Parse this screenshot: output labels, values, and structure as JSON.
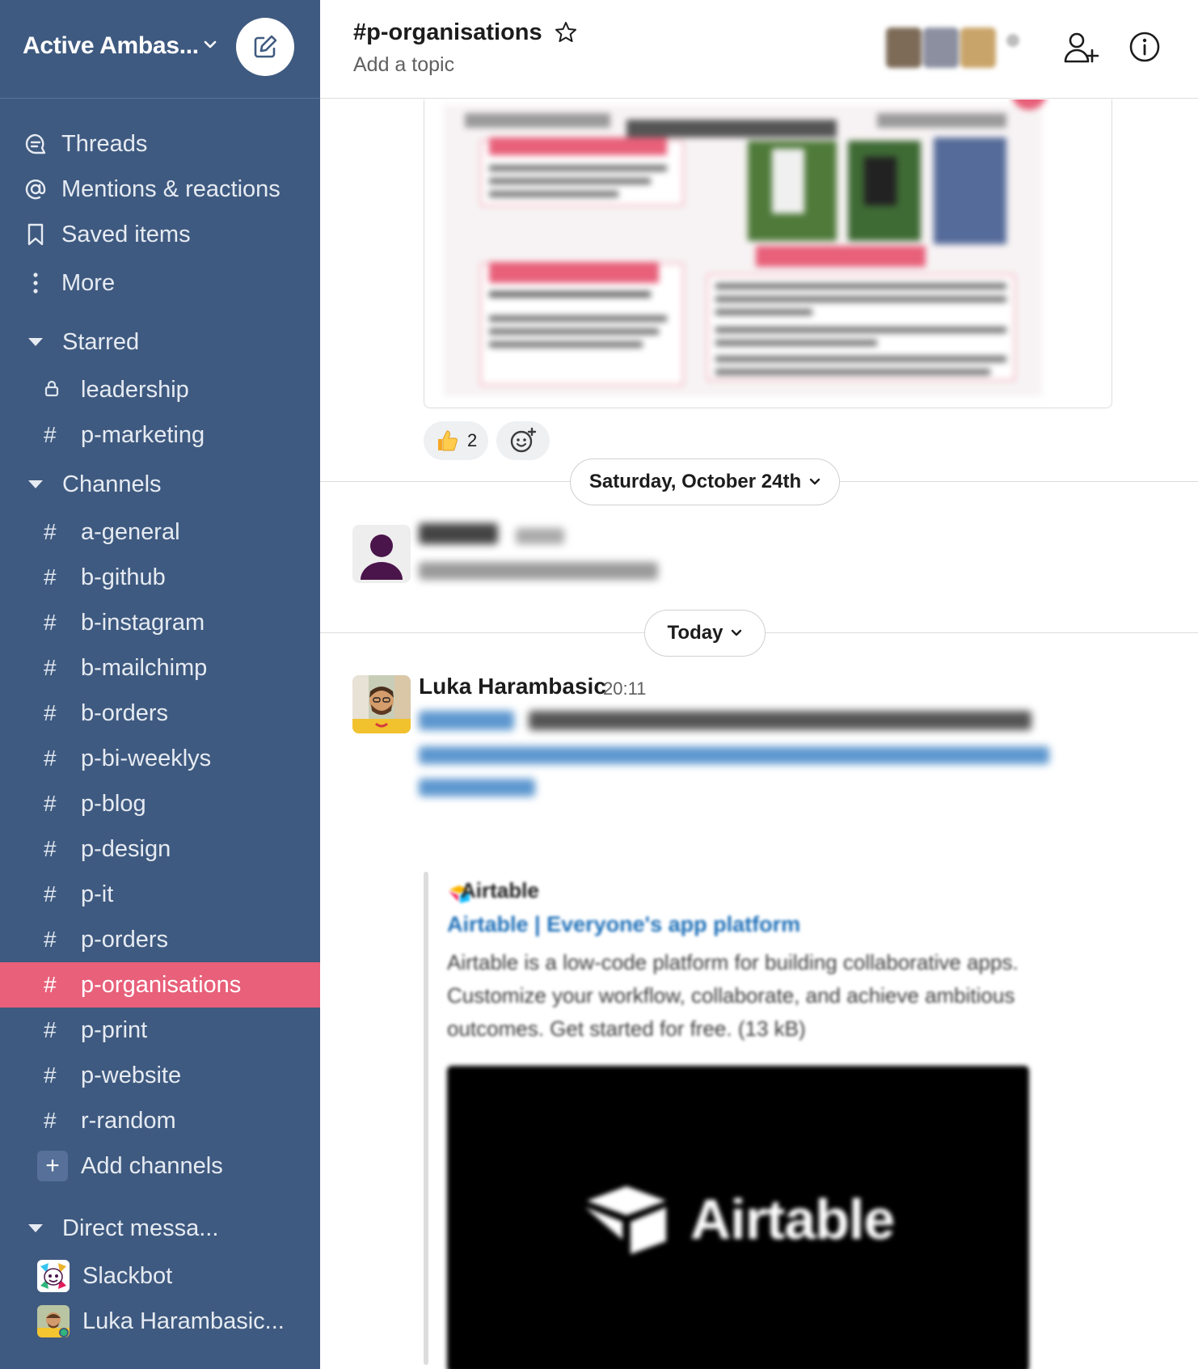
{
  "workspace": {
    "name": "Active Ambas..."
  },
  "nav": [
    {
      "icon": "threads-icon",
      "label": "Threads"
    },
    {
      "icon": "at-sign-icon",
      "label": "Mentions & reactions"
    },
    {
      "icon": "bookmark-icon",
      "label": "Saved items"
    },
    {
      "icon": "more-vertical-icon",
      "label": "More"
    }
  ],
  "sections": {
    "starred": "Starred",
    "channels": "Channels",
    "direct": "Direct messa..."
  },
  "starred_items": [
    {
      "prefix": "lock",
      "label": "leadership"
    },
    {
      "prefix": "#",
      "label": "p-marketing"
    }
  ],
  "channels": [
    {
      "hash": "#",
      "label": "a-general"
    },
    {
      "hash": "#",
      "label": "b-github"
    },
    {
      "hash": "#",
      "label": "b-instagram"
    },
    {
      "hash": "#",
      "label": "b-mailchimp"
    },
    {
      "hash": "#",
      "label": "b-orders"
    },
    {
      "hash": "#",
      "label": "p-bi-weeklys"
    },
    {
      "hash": "#",
      "label": "p-blog"
    },
    {
      "hash": "#",
      "label": "p-design"
    },
    {
      "hash": "#",
      "label": "p-it"
    },
    {
      "hash": "#",
      "label": "p-orders"
    },
    {
      "hash": "#",
      "label": "p-organisations"
    },
    {
      "hash": "#",
      "label": "p-print"
    },
    {
      "hash": "#",
      "label": "p-website"
    },
    {
      "hash": "#",
      "label": "r-random"
    }
  ],
  "add_channels": {
    "plus": "+",
    "label": "Add channels"
  },
  "direct_messages": [
    {
      "label": "Slackbot"
    },
    {
      "label": "Luka Harambasic..."
    }
  ],
  "header": {
    "channel": "#p-organisations",
    "topic": "Add a topic"
  },
  "reactions": {
    "thumbs_count": "2"
  },
  "dates": {
    "first": "Saturday, October 24th",
    "second": "Today"
  },
  "message": {
    "author": "Luka Harambasic",
    "time": "20:11"
  },
  "attachment": {
    "site": "Airtable",
    "title": "Airtable | Everyone's app platform",
    "description": "Airtable is a low-code platform for building collaborative apps. Customize your workflow, collaborate, and achieve ambitious outcomes. Get started for free. (13 kB)",
    "image_brand": "Airtable"
  },
  "colors": {
    "sidebar": "#3f5a80",
    "active_channel": "#e8607a",
    "link": "#1d6fb8"
  }
}
